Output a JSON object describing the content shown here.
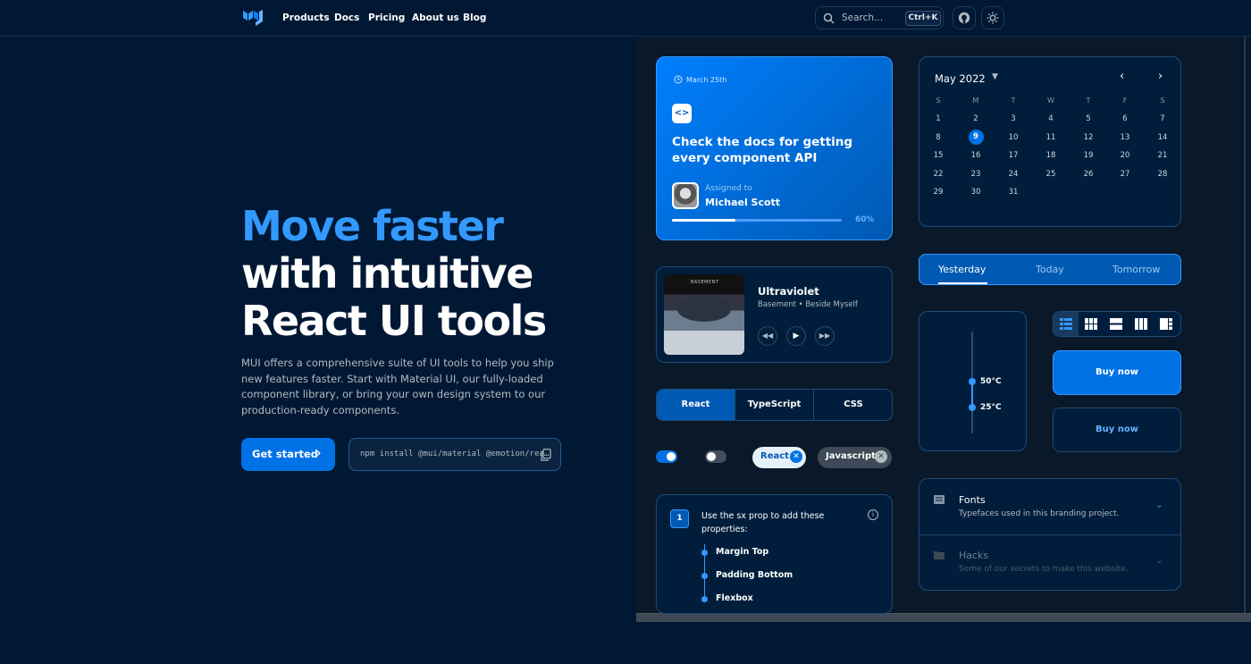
{
  "header": {
    "nav": [
      "Products",
      "Docs",
      "Pricing",
      "About us",
      "Blog"
    ],
    "search_placeholder": "Search...",
    "shortcut": "Ctrl+K"
  },
  "hero": {
    "line1": "Move faster",
    "line2": "with intuitive",
    "line3": "React UI tools",
    "description": "MUI offers a comprehensive suite of UI tools to help you ship new features faster. Start with Material UI, our fully-loaded component library, or bring your own design system to our production-ready components.",
    "cta": "Get started",
    "install_cmd": "npm install @mui/material @emotion/rea…"
  },
  "task_card": {
    "date": "March 25th",
    "title": "Check the docs for getting every component API",
    "assigned_label": "Assigned to",
    "assignee": "Michael Scott",
    "progress": 0.6,
    "progress_label": "60%"
  },
  "calendar": {
    "month": "May 2022",
    "weekdays": [
      "S",
      "M",
      "T",
      "W",
      "T",
      "F",
      "S"
    ],
    "first_weekday_index": 0,
    "days_in_month": 31,
    "selected_day": 9
  },
  "player": {
    "cover_text": "BASEMENT\nBESIDE MYSELF",
    "song": "Ultraviolet",
    "artist": "Basement • Beside Myself"
  },
  "day_tabs": {
    "items": [
      "Yesterday",
      "Today",
      "Tomorrow"
    ],
    "selected": "Yesterday"
  },
  "lang_toggle": {
    "items": [
      "React",
      "TypeScript",
      "CSS"
    ],
    "selected": "React"
  },
  "slider": {
    "high": "50°C",
    "low": "25°C"
  },
  "buy_buttons": {
    "primary": "Buy now",
    "secondary": "Buy now"
  },
  "chips": {
    "react": "React",
    "javascript": "Javascript"
  },
  "switches": {
    "first_on": true,
    "second_on": false
  },
  "stepper": {
    "step_number": "1",
    "title": "Use the sx prop to add these properties:",
    "items": [
      "Margin Top",
      "Padding Bottom",
      "Flexbox"
    ]
  },
  "accordion": {
    "items": [
      {
        "title": "Fonts",
        "subtitle": "Typefaces used in this branding project."
      },
      {
        "title": "Hacks",
        "subtitle": "Some of our secrets to make this website."
      }
    ]
  },
  "colors": {
    "background": "#001833",
    "primary": "#0072e5",
    "accent": "#3399ff"
  }
}
